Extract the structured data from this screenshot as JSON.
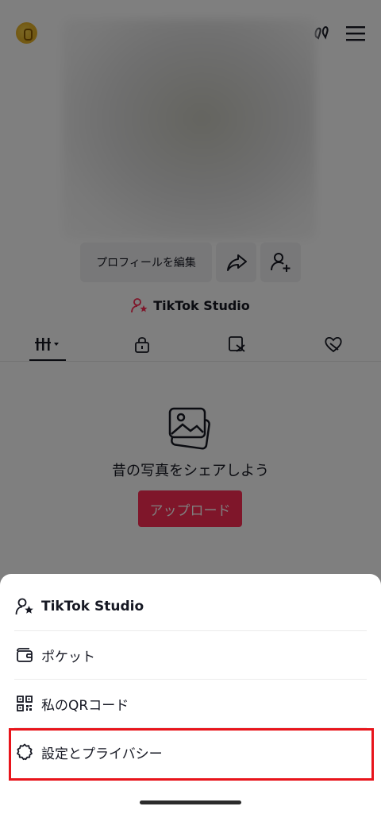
{
  "profile": {
    "edit_button": "プロフィールを編集",
    "studio_link": "TikTok Studio",
    "empty_state": {
      "message": "昔の写真をシェアしよう",
      "upload_button": "アップロード"
    },
    "tabs": [
      "videos-grid-icon",
      "lock-icon",
      "tagged-icon",
      "liked-icon"
    ]
  },
  "sheet": {
    "items": [
      {
        "label": "TikTok Studio",
        "icon": "person-star-icon"
      },
      {
        "label": "ポケット",
        "icon": "wallet-icon"
      },
      {
        "label": "私のQRコード",
        "icon": "qr-code-icon"
      },
      {
        "label": "設定とプライバシー",
        "icon": "gear-icon"
      }
    ]
  },
  "colors": {
    "accent": "#fe2c55",
    "highlight": "#e8141b"
  }
}
